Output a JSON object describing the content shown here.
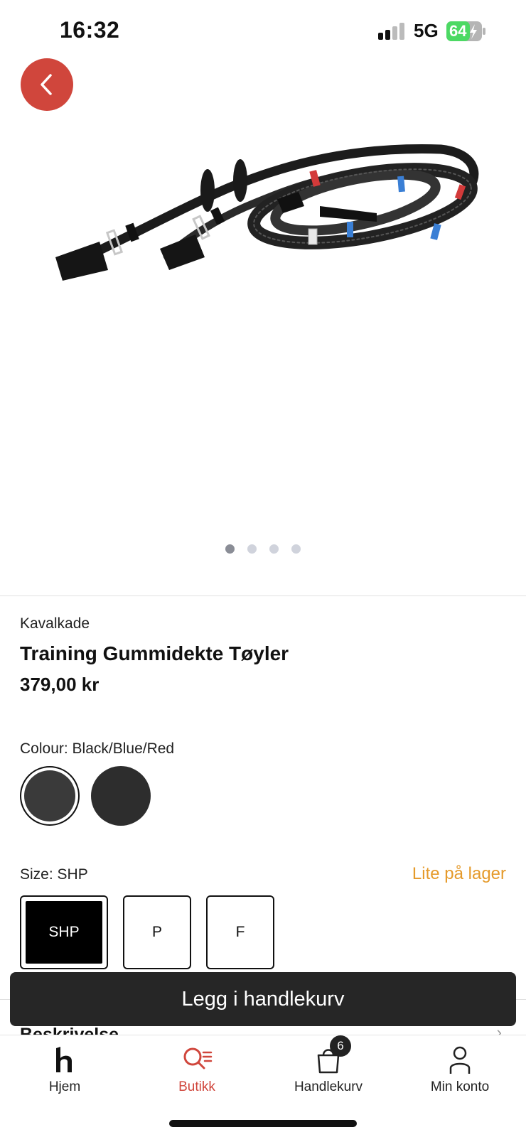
{
  "status_bar": {
    "time": "16:32",
    "network": "5G",
    "battery": "64"
  },
  "colors": {
    "accent": "#d0463c",
    "stock_warning": "#e59a2b",
    "button_dark": "#262626"
  },
  "product": {
    "brand": "Kavalkade",
    "title": "Training Gummidekte Tøyler",
    "price": "379,00 kr",
    "image_count": 4,
    "active_image": 1
  },
  "colour": {
    "label": "Colour: Black/Blue/Red",
    "swatches": [
      {
        "color": "#3a3a3a",
        "selected": true
      },
      {
        "color": "#2d2d2d",
        "selected": false
      }
    ]
  },
  "size": {
    "label": "Size: SHP",
    "stock_status": "Lite på lager",
    "options": [
      {
        "label": "SHP",
        "selected": true
      },
      {
        "label": "P",
        "selected": false
      },
      {
        "label": "F",
        "selected": false
      }
    ]
  },
  "cart_button": {
    "label": "Legg i handlekurv"
  },
  "description": {
    "label": "Beskrivelse"
  },
  "tab_bar": {
    "tabs": [
      {
        "label": "Hjem",
        "icon": "home-h-icon",
        "active": false
      },
      {
        "label": "Butikk",
        "icon": "search-list-icon",
        "active": true
      },
      {
        "label": "Handlekurv",
        "icon": "shopping-bag-icon",
        "active": false,
        "badge": "6"
      },
      {
        "label": "Min konto",
        "icon": "user-icon",
        "active": false
      }
    ]
  }
}
